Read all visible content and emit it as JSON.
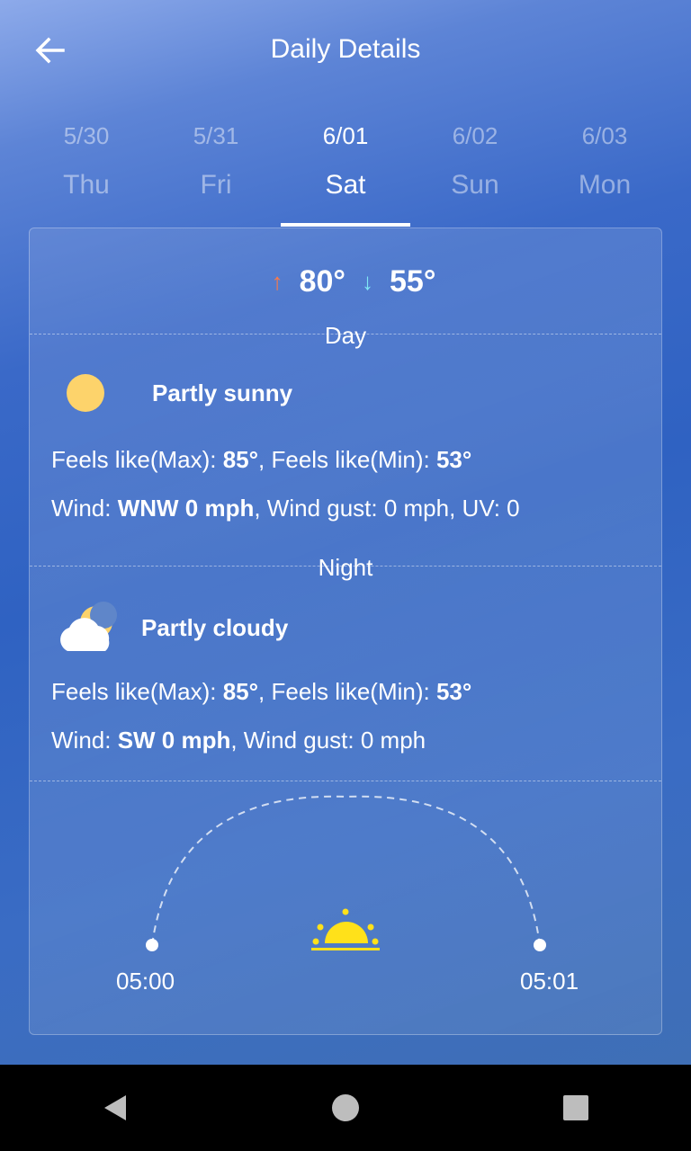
{
  "header": {
    "title": "Daily Details",
    "back_icon": "arrow-left-icon"
  },
  "tabs": [
    {
      "date": "5/30",
      "day": "Thu",
      "active": false
    },
    {
      "date": "5/31",
      "day": "Fri",
      "active": false
    },
    {
      "date": "6/01",
      "day": "Sat",
      "active": true
    },
    {
      "date": "6/02",
      "day": "Sun",
      "active": false
    },
    {
      "date": "6/03",
      "day": "Mon",
      "active": false
    }
  ],
  "summary": {
    "high": "80°",
    "low": "55°",
    "up_arrow": "↑",
    "down_arrow": "↓"
  },
  "day": {
    "label": "Day",
    "condition": "Partly sunny",
    "icon": "sun-icon",
    "feels_max_label": "Feels like(Max): ",
    "feels_max": "85°",
    "feels_min_label": ", Feels like(Min): ",
    "feels_min": "53°",
    "wind_label": "Wind: ",
    "wind": "WNW 0 mph",
    "wind_rest": ", Wind gust: 0 mph, UV: 0"
  },
  "night": {
    "label": "Night",
    "condition": "Partly cloudy",
    "icon": "cloud-moon-icon",
    "feels_max_label": "Feels like(Max): ",
    "feels_max": "85°",
    "feels_min_label": ", Feels like(Min): ",
    "feels_min": "53°",
    "wind_label": "Wind: ",
    "wind": "SW 0 mph",
    "wind_rest": ", Wind gust: 0 mph"
  },
  "sun": {
    "sunrise": "05:00",
    "sunset": "05:01",
    "icon": "sunrise-icon"
  },
  "colors": {
    "sun": "#fdd36b",
    "sunrise": "#ffe11a",
    "arrow_up": "#ff7a45",
    "arrow_down": "#7fe7f5"
  },
  "navbar": {
    "back": "nav-back-icon",
    "home": "nav-home-icon",
    "recents": "nav-recents-icon"
  }
}
